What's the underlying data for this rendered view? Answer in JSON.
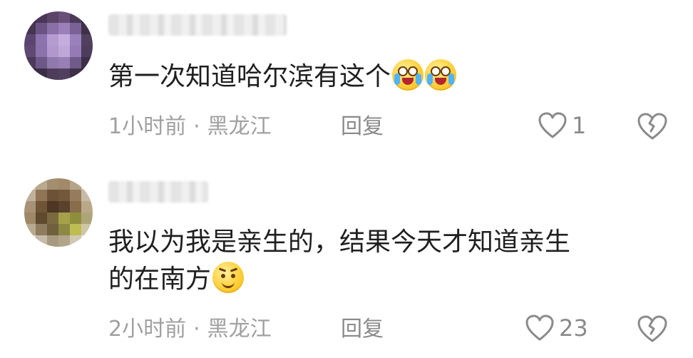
{
  "comments": [
    {
      "text_line1": "第一次知道哈尔滨有这个",
      "text_line2": "",
      "emojis": [
        "crying-laugh-emoji",
        "crying-laugh-emoji"
      ],
      "time": "1小时前",
      "location": "黑龙江",
      "separator": "·",
      "reply_label": "回复",
      "like_count": "1",
      "avatar_colors": [
        "#3a2c44",
        "#4a3656",
        "#5c4468",
        "#6a4f78",
        "#4c3a58",
        "#332838",
        "#463451",
        "#6b5484",
        "#8a70a6",
        "#9b7fb8",
        "#7a6296",
        "#3f3048",
        "#5a4570",
        "#8c73ad",
        "#b49bd0",
        "#c4aede",
        "#9a80bc",
        "#50405e",
        "#5e4a72",
        "#8b72aa",
        "#b197cd",
        "#bfa7d8",
        "#957ab6",
        "#4e3c5c",
        "#4b3a5a",
        "#6e5888",
        "#9079ad",
        "#9880b6",
        "#705a8a",
        "#3d2f48",
        "#2e2434",
        "#3b2e44",
        "#4d3c5a",
        "#523f60",
        "#3e3048",
        "#2a2130"
      ]
    },
    {
      "text_line1": "我以为我是亲生的，结果今天才知道亲生",
      "text_line2": "的在南方",
      "emojis": [
        "sly-smile-emoji"
      ],
      "time": "2小时前",
      "location": "黑龙江",
      "separator": "·",
      "reply_label": "回复",
      "like_count": "23",
      "avatar_colors": [
        "#cfc7b8",
        "#b8a98f",
        "#a38e70",
        "#a2896a",
        "#b5a489",
        "#d6d0c4",
        "#bfb09a",
        "#8f7556",
        "#6e5238",
        "#74583c",
        "#967c5c",
        "#c7bba6",
        "#a89276",
        "#6f5437",
        "#4d3623",
        "#5a412b",
        "#8a6d4b",
        "#b9a888",
        "#9e8868",
        "#5f4a30",
        "#7b6a3e",
        "#a6a04a",
        "#8f8e3c",
        "#aea47a",
        "#b8aa90",
        "#8f7b5e",
        "#70603e",
        "#8d8844",
        "#bdbd52",
        "#cfc6a8",
        "#e2ddd2",
        "#c6bba8",
        "#a89a80",
        "#b1a68a",
        "#cfc8b4",
        "#ebe8e0"
      ]
    }
  ]
}
